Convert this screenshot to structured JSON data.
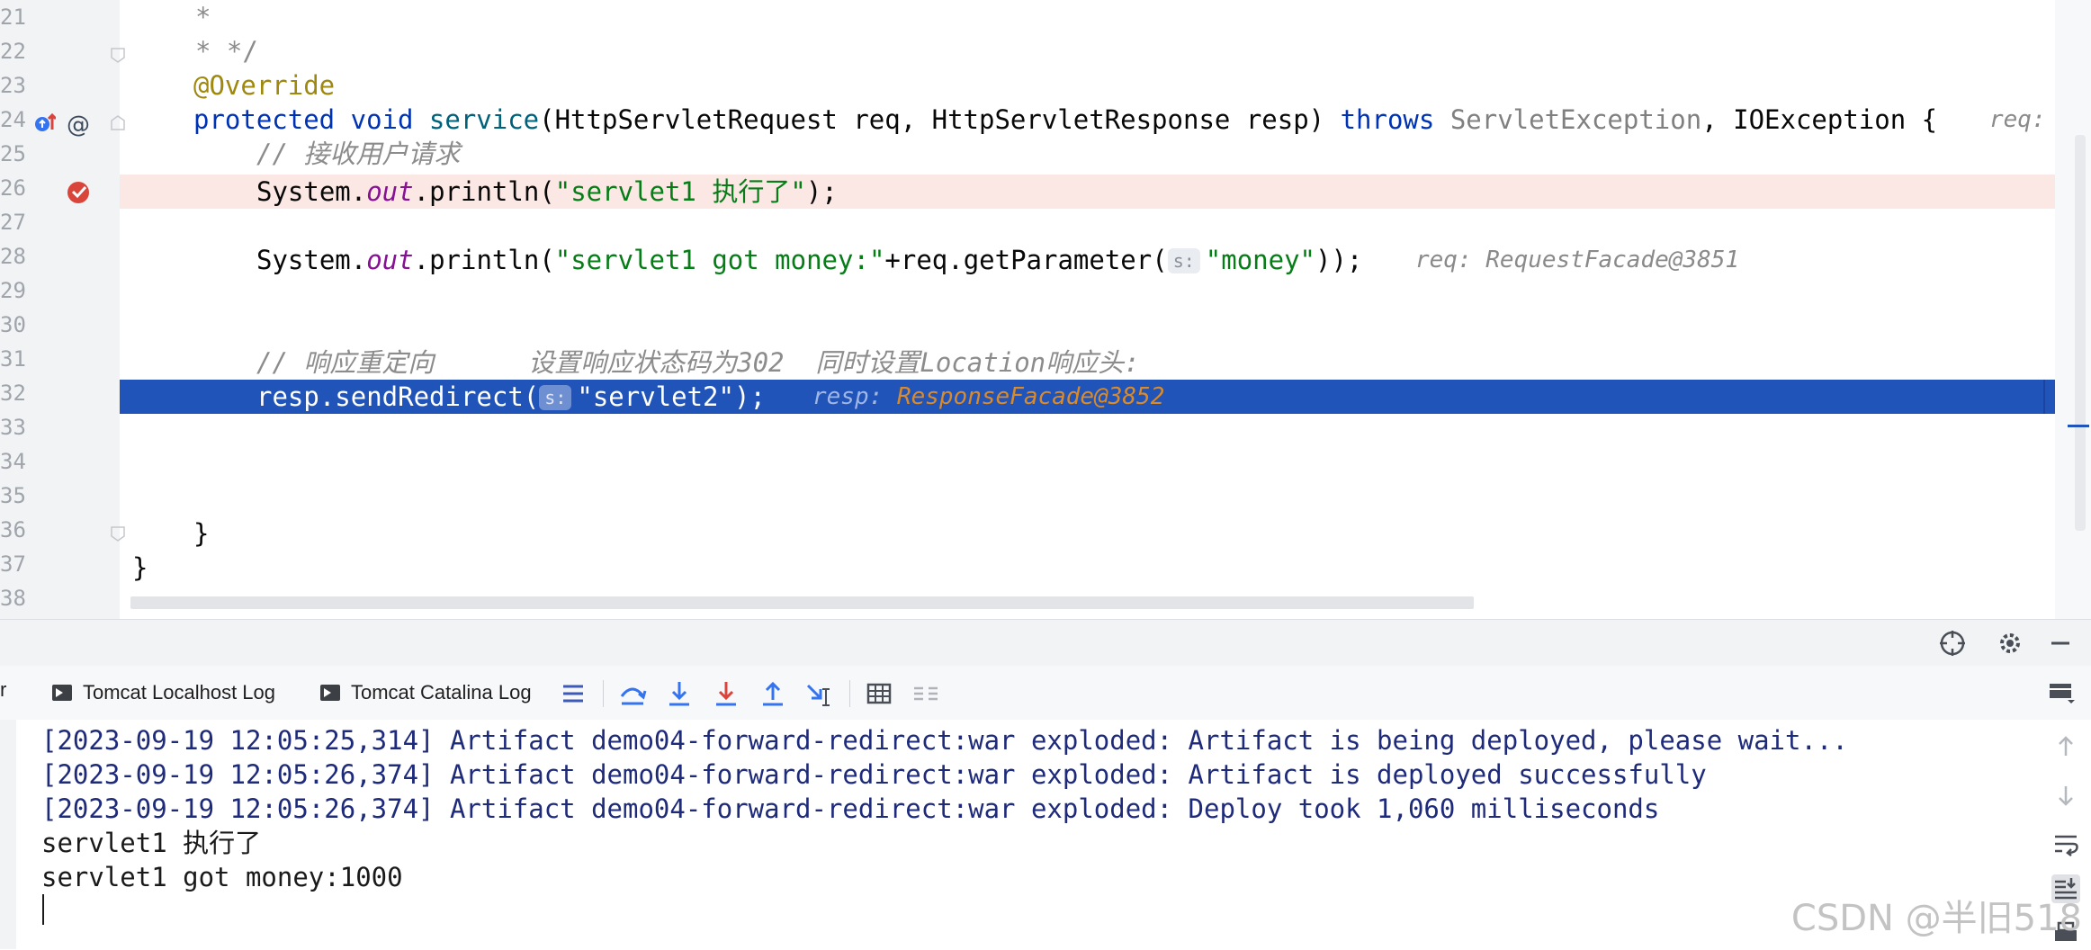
{
  "editor": {
    "line_numbers": [
      "21",
      "22",
      "23",
      "24",
      "25",
      "26",
      "27",
      "28",
      "29",
      "30",
      "31",
      "32",
      "33",
      "34",
      "35",
      "36",
      "37",
      "38"
    ],
    "l21": "*",
    "l22": "* */",
    "l23_annotation": "@Override",
    "l24": {
      "protected": "protected",
      "void": "void",
      "method": "service",
      "params": "(HttpServletRequest req, HttpServletResponse resp)",
      "throws": "throws",
      "exc1": "ServletException",
      "comma": ", IOException {",
      "hint": "req: R"
    },
    "l25_comment": "// 接收用户请求",
    "l26": {
      "prefix": "System.",
      "field": "out",
      "call": ".println(",
      "string": "\"servlet1 执行了\"",
      "end": ");"
    },
    "l28": {
      "prefix": "System.",
      "field": "out",
      "call": ".println(",
      "string1": "\"servlet1 got money:\"",
      "mid": "+req.getParameter(",
      "param_hint": "s:",
      "string2": "\"money\"",
      "end": "));",
      "hint": "req: RequestFacade@3851"
    },
    "l31_comment": "// 响应重定向      设置响应状态码为302  同时设置Location响应头:",
    "l32": {
      "prefix": "resp.sendRedirect(",
      "param_hint": "s:",
      "string": "\"servlet2\"",
      "end": ");",
      "hint_label": "resp:",
      "hint_value": "ResponseFacade@3852"
    },
    "l36": "}",
    "l37": "}"
  },
  "tabs": {
    "localhost_log": "Tomcat Localhost Log",
    "catalina_log": "Tomcat Catalina Log"
  },
  "console": {
    "lines": [
      "[2023-09-19 12:05:25,314] Artifact demo04-forward-redirect:war exploded: Artifact is being deployed, please wait...",
      "[2023-09-19 12:05:26,374] Artifact demo04-forward-redirect:war exploded: Artifact is deployed successfully",
      "[2023-09-19 12:05:26,374] Artifact demo04-forward-redirect:war exploded: Deploy took 1,060 milliseconds",
      "servlet1 执行了",
      "servlet1 got money:1000"
    ],
    "watermark": "CSDN @半旧518"
  },
  "colors": {
    "keyword": "#0033b3",
    "string": "#067d17",
    "annotation": "#9e880d",
    "execution_line": "#2154b8",
    "breakpoint_line": "#fbe7e4",
    "breakpoint": "#d9443b"
  },
  "icons": [
    "override-up-icon",
    "at-icon",
    "breakpoint-icon",
    "fold-icon",
    "crosshair-icon",
    "gear-icon",
    "minimize-icon",
    "terminal-icon",
    "list-icon",
    "step-over-icon",
    "step-into-icon",
    "force-step-into-icon",
    "step-out-icon",
    "run-to-cursor-icon",
    "table-icon",
    "threads-icon",
    "layout-icon",
    "scroll-up-icon",
    "scroll-down-icon",
    "soft-wrap-icon",
    "scroll-to-end-icon",
    "print-icon"
  ]
}
